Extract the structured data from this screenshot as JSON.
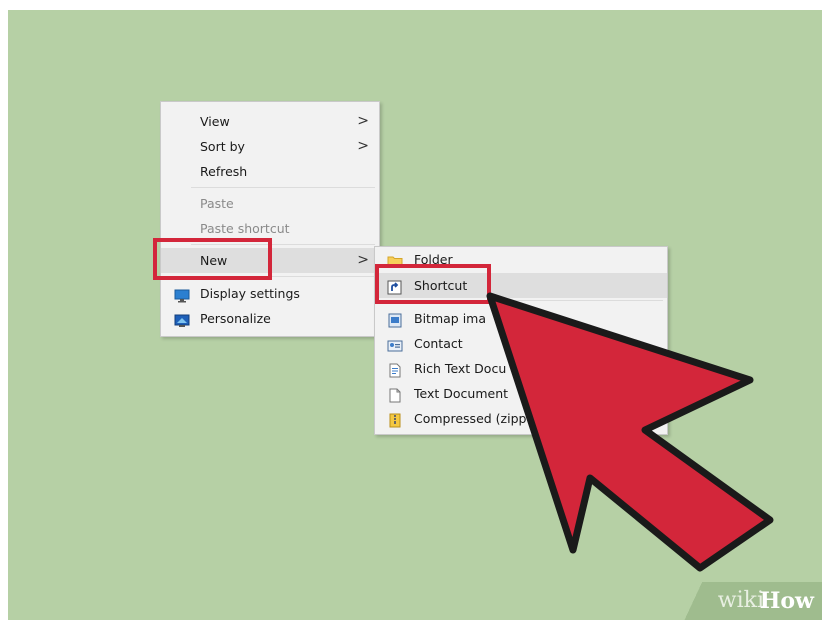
{
  "main_menu": {
    "items": [
      {
        "label": "View",
        "arrow": ">"
      },
      {
        "label": "Sort by",
        "arrow": ">"
      },
      {
        "label": "Refresh"
      },
      {
        "label": "Paste"
      },
      {
        "label": "Paste shortcut"
      },
      {
        "label": "New",
        "arrow": ">"
      },
      {
        "label": "Display settings",
        "icon": "display-settings-icon"
      },
      {
        "label": "Personalize",
        "icon": "personalize-icon"
      }
    ]
  },
  "new_submenu": {
    "items": [
      {
        "label": "Folder",
        "icon": "folder-icon"
      },
      {
        "label": "Shortcut",
        "icon": "shortcut-icon"
      },
      {
        "label": "Bitmap ima",
        "icon": "bitmap-icon"
      },
      {
        "label": "Contact",
        "icon": "contact-icon"
      },
      {
        "label": "Rich Text Docu",
        "icon": "rich-text-document-icon"
      },
      {
        "label": "Text Document",
        "icon": "text-document-icon"
      },
      {
        "label": "Compressed (zipped",
        "icon": "compressed-folder-icon"
      }
    ]
  },
  "watermark": {
    "wiki": "wiki",
    "how": "How"
  },
  "colors": {
    "desktop": "#b6d0a5",
    "menu_bg": "#f2f2f2",
    "highlight": "#dedede",
    "annotation_red": "#d3263a"
  }
}
